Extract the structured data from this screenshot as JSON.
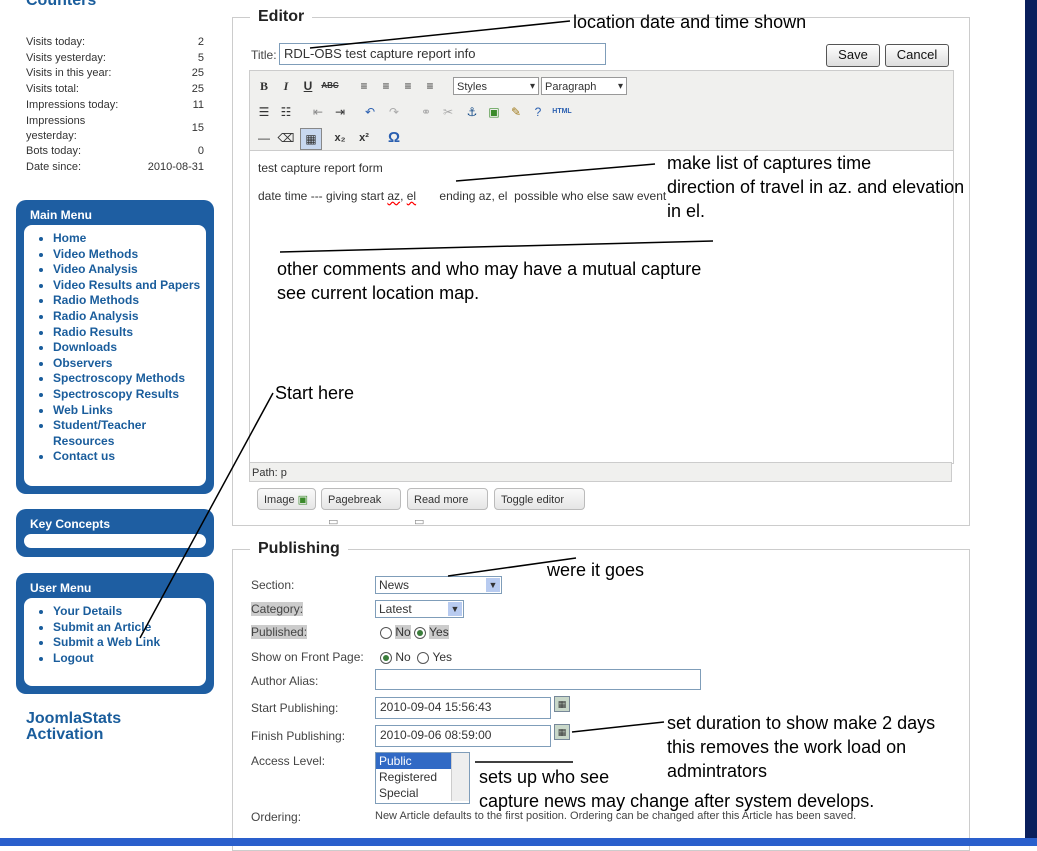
{
  "sidebar": {
    "counters_title": "Counters",
    "stats": [
      {
        "label": "Visits today:",
        "value": "2"
      },
      {
        "label": "Visits yesterday:",
        "value": "5"
      },
      {
        "label": "Visits in this year:",
        "value": "25"
      },
      {
        "label": "Visits total:",
        "value": "25"
      },
      {
        "label": "Impressions today:",
        "value": "11"
      },
      {
        "label": "Impressions yesterday:",
        "value": "15"
      },
      {
        "label": "Bots today:",
        "value": "0"
      },
      {
        "label": "Date since:",
        "value": "2010-08-31"
      }
    ],
    "main_menu": {
      "title": "Main Menu",
      "items": [
        "Home",
        "Video Methods",
        "Video Analysis",
        "Video Results and Papers",
        "Radio Methods",
        "Radio Analysis",
        "Radio Results",
        "Downloads",
        "Observers",
        "Spectroscopy Methods",
        "Spectroscopy Results",
        "Web Links",
        "Student/Teacher Resources",
        "Contact us"
      ]
    },
    "key_concepts": {
      "title": "Key Concepts"
    },
    "user_menu": {
      "title": "User Menu",
      "items": [
        "Your Details",
        "Submit an Article",
        "Submit a Web Link",
        "Logout"
      ]
    },
    "jstats_line1": "JoomlaStats",
    "jstats_line2": "Activation"
  },
  "editor": {
    "legend": "Editor",
    "title_label": "Title:",
    "title_value": "RDL-OBS  test capture report info",
    "save": "Save",
    "cancel": "Cancel",
    "styles_select": "Styles",
    "format_select": "Paragraph",
    "content_line1": "test capture report form",
    "content_line2a": "date time --- giving start ",
    "content_az": "az",
    "content_comma": ", ",
    "content_el": "el",
    "content_line2b": "       ending az, el  possible who else saw event",
    "path": "Path: p",
    "buttons": [
      "Image",
      "Pagebreak",
      "Read more",
      "Toggle editor"
    ]
  },
  "publishing": {
    "legend": "Publishing",
    "section_label": "Section:",
    "section_value": "News",
    "category_label": "Category:",
    "category_value": "Latest",
    "published_label": "Published:",
    "no": "No",
    "yes": "Yes",
    "frontpage_label": "Show on Front Page:",
    "alias_label": "Author Alias:",
    "start_label": "Start Publishing:",
    "start_value": "2010-09-04 15:56:43",
    "finish_label": "Finish Publishing:",
    "finish_value": "2010-09-06 08:59:00",
    "access_label": "Access Level:",
    "access_options": [
      "Public",
      "Registered",
      "Special"
    ],
    "ordering_label": "Ordering:",
    "ordering_text": "New Article defaults to the first position. Ordering can be changed after this Article has been saved."
  },
  "annotations": {
    "location": "location date and time  shown",
    "list_1": "make list of captures time",
    "list_2": "direction of travel in az. and elevation",
    "list_3": "in el.",
    "comments_1": "other comments   and who may have a mutual capture",
    "comments_2": "see current location map.",
    "start": "Start here",
    "where": "were it goes",
    "duration_1": "set duration to show make 2 days",
    "duration_2": "this removes the work load on",
    "duration_3": "admintrators",
    "access_1": "sets up who see",
    "access_2": "capture news may change after system develops."
  }
}
